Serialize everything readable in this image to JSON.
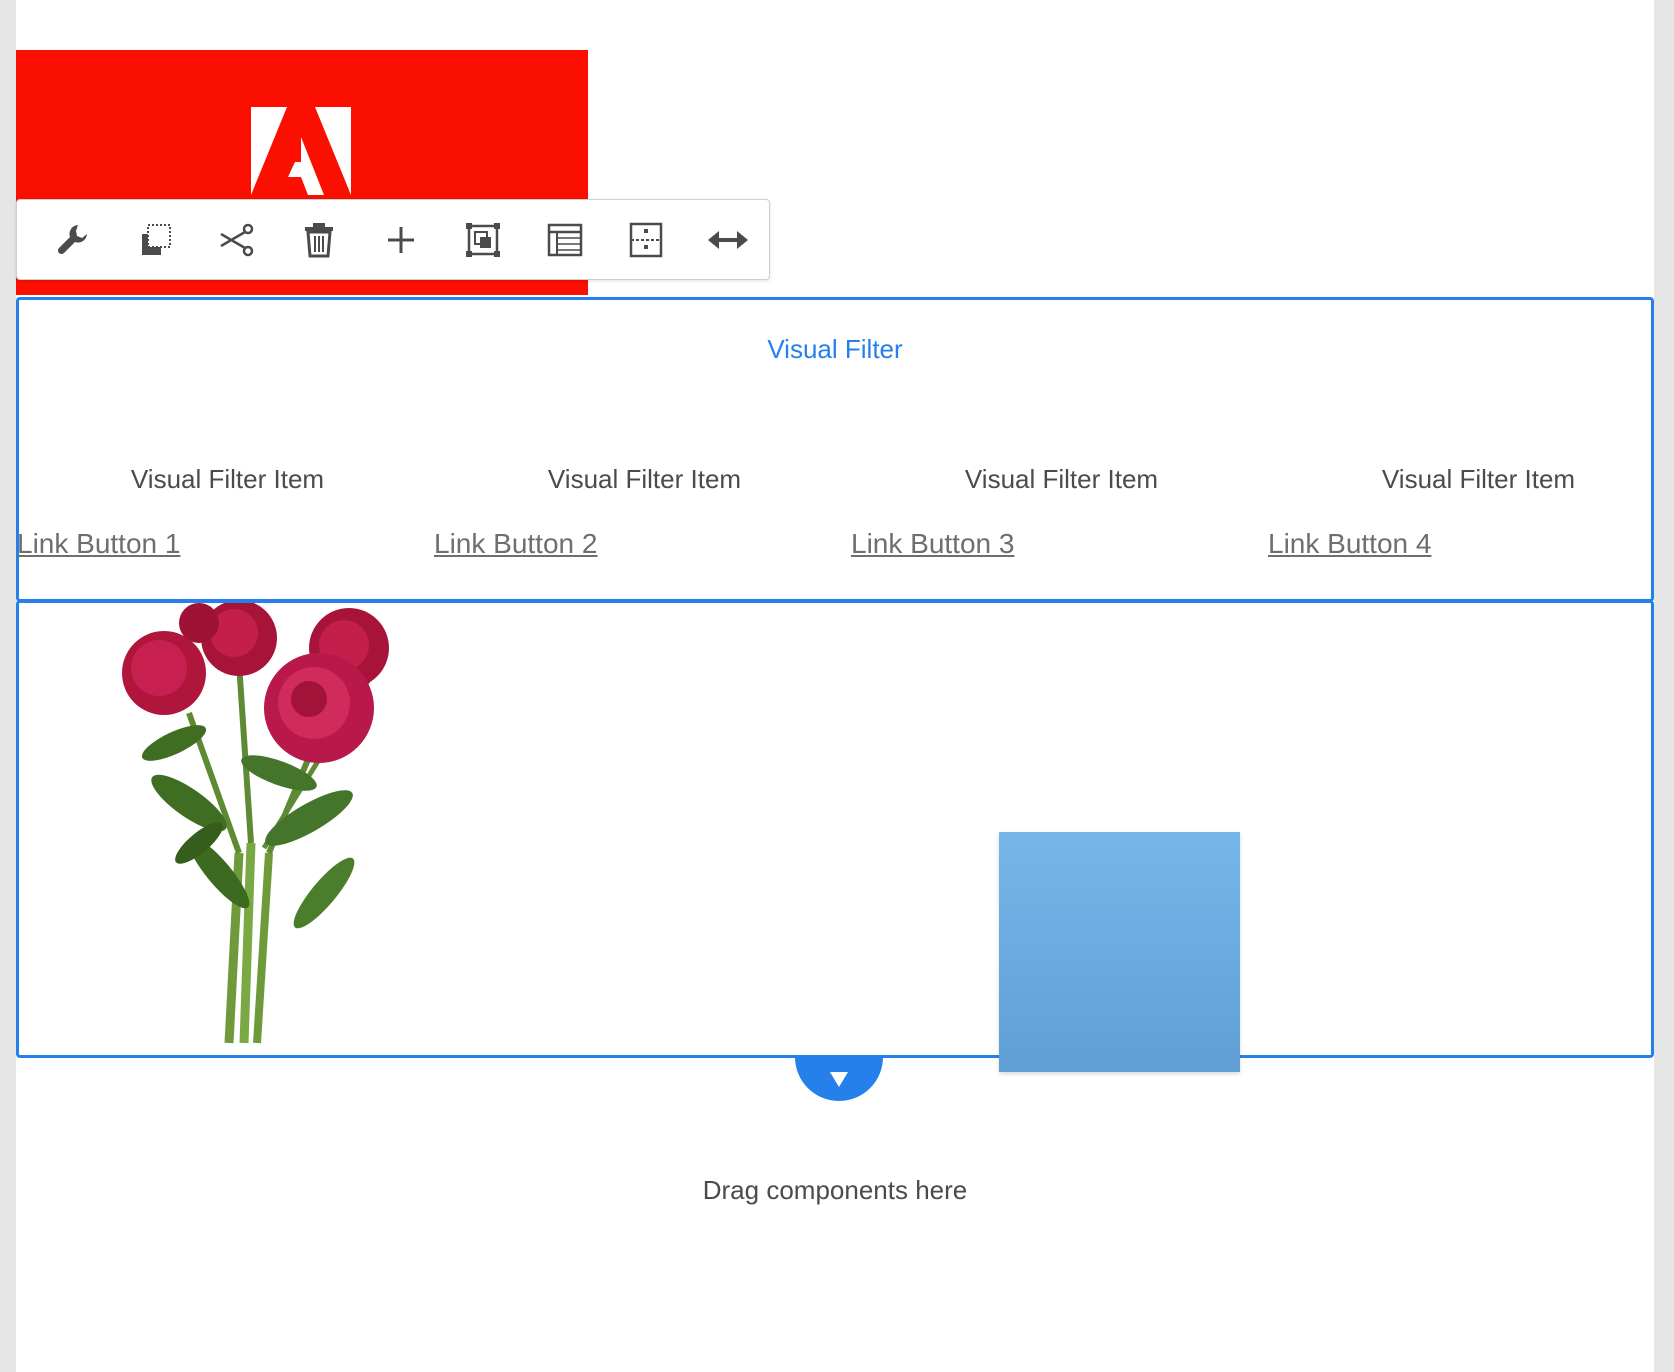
{
  "visual_filter": {
    "title": "Visual Filter",
    "items": [
      {
        "label": "Visual Filter Item",
        "link": "Link Button 1"
      },
      {
        "label": "Visual Filter Item",
        "link": "Link Button 2"
      },
      {
        "label": "Visual Filter Item",
        "link": "Link Button 3"
      },
      {
        "label": "Visual Filter Item",
        "link": "Link Button 4"
      }
    ]
  },
  "toolbar": {
    "icons": [
      "wrench-icon",
      "copy-icon",
      "cut-icon",
      "delete-icon",
      "add-icon",
      "group-icon",
      "layout-icon",
      "parent-icon",
      "resize-icon"
    ]
  },
  "drop_zone": {
    "text": "Drag components here"
  },
  "colors": {
    "accent": "#2680eb",
    "adobe_red": "#fa0f00",
    "drag_square": "#6aaee2"
  }
}
